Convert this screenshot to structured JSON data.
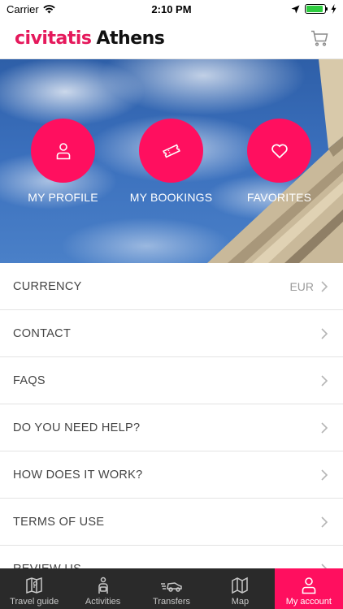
{
  "status_bar": {
    "carrier": "Carrier",
    "time": "2:10 PM",
    "battery_level": 0.9
  },
  "header": {
    "brand": "civitatis",
    "city": "Athens",
    "cart_icon": "cart-icon"
  },
  "hero": {
    "actions": [
      {
        "label": "MY PROFILE",
        "icon": "person-icon"
      },
      {
        "label": "MY BOOKINGS",
        "icon": "ticket-icon"
      },
      {
        "label": "FAVORITES",
        "icon": "heart-icon"
      }
    ]
  },
  "menu": {
    "items": [
      {
        "label": "CURRENCY",
        "value": "EUR"
      },
      {
        "label": "CONTACT"
      },
      {
        "label": "FAQS"
      },
      {
        "label": "DO YOU NEED HELP?"
      },
      {
        "label": "HOW DOES IT WORK?"
      },
      {
        "label": "TERMS OF USE"
      },
      {
        "label": "REVIEW US"
      }
    ]
  },
  "tabbar": {
    "tabs": [
      {
        "label": "Travel guide",
        "icon": "map-book-icon"
      },
      {
        "label": "Activities",
        "icon": "activities-icon"
      },
      {
        "label": "Transfers",
        "icon": "car-icon"
      },
      {
        "label": "Map",
        "icon": "map-icon"
      },
      {
        "label": "My account",
        "icon": "account-icon",
        "active": true
      }
    ]
  },
  "colors": {
    "accent": "#ff0f5f",
    "brand": "#e5195c",
    "tabbar": "#2a2a2a"
  }
}
